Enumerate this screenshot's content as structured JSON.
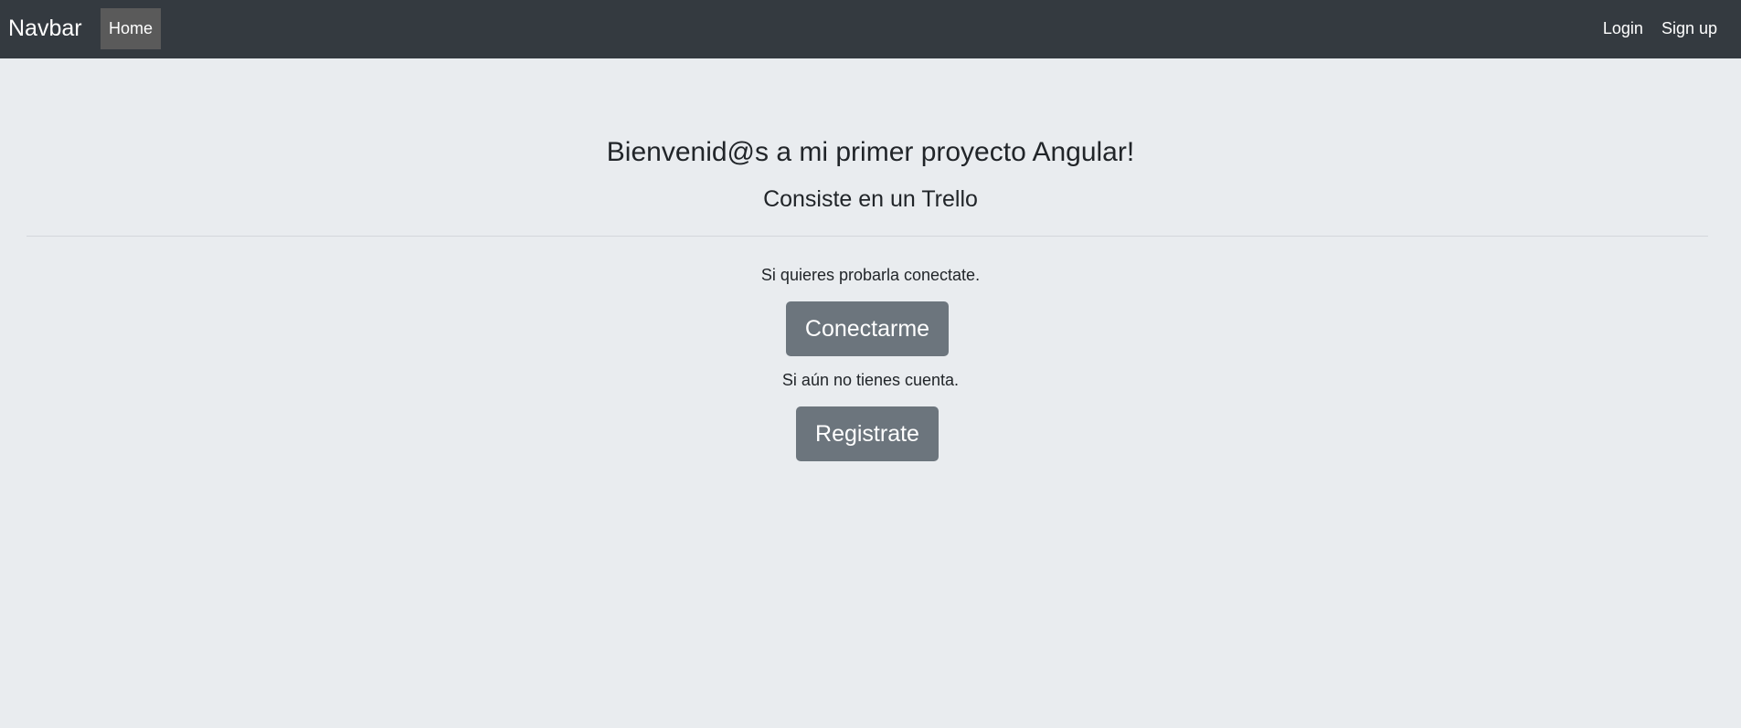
{
  "navbar": {
    "brand": "Navbar",
    "home": "Home",
    "login": "Login",
    "signup": "Sign up"
  },
  "main": {
    "title": "Bienvenid@s a mi primer proyecto Angular!",
    "subtitle": "Consiste en un Trello",
    "login_prompt": "Si quieres probarla conectate.",
    "login_button": "Conectarme",
    "register_prompt": "Si aún no tienes cuenta.",
    "register_button": "Registrate"
  },
  "colors": {
    "navbar_bg": "#343a40",
    "page_bg": "#e9ecef",
    "button_bg": "#6c757d",
    "active_nav_bg": "#5a5a5a"
  }
}
